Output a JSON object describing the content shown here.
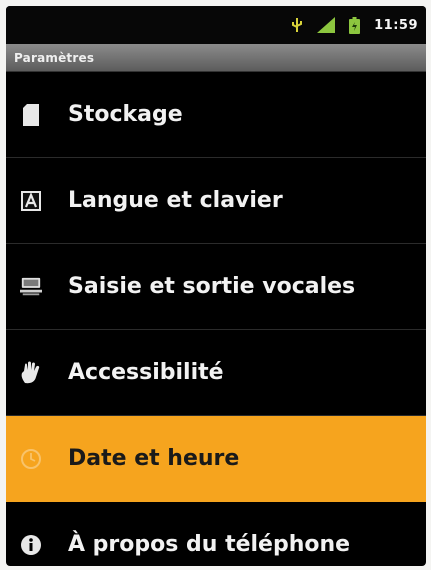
{
  "status_bar": {
    "time": "11:59",
    "icons": [
      "usb-icon",
      "signal-icon",
      "battery-icon"
    ]
  },
  "title_bar": {
    "title": "Paramètres"
  },
  "settings": {
    "items": [
      {
        "label": "Stockage",
        "icon": "sd-card-icon"
      },
      {
        "label": "Langue et clavier",
        "icon": "keyboard-letter-icon"
      },
      {
        "label": "Saisie et sortie vocales",
        "icon": "voice-io-icon"
      },
      {
        "label": "Accessibilité",
        "icon": "hand-icon"
      },
      {
        "label": "Date et heure",
        "icon": "clock-icon",
        "selected": true
      },
      {
        "label": "À propos du téléphone",
        "icon": "info-icon"
      }
    ]
  },
  "colors": {
    "highlight": "#f6a41e",
    "background": "#000000",
    "title_bar": "#6e6e6e",
    "status_green": "#8cc63f"
  }
}
